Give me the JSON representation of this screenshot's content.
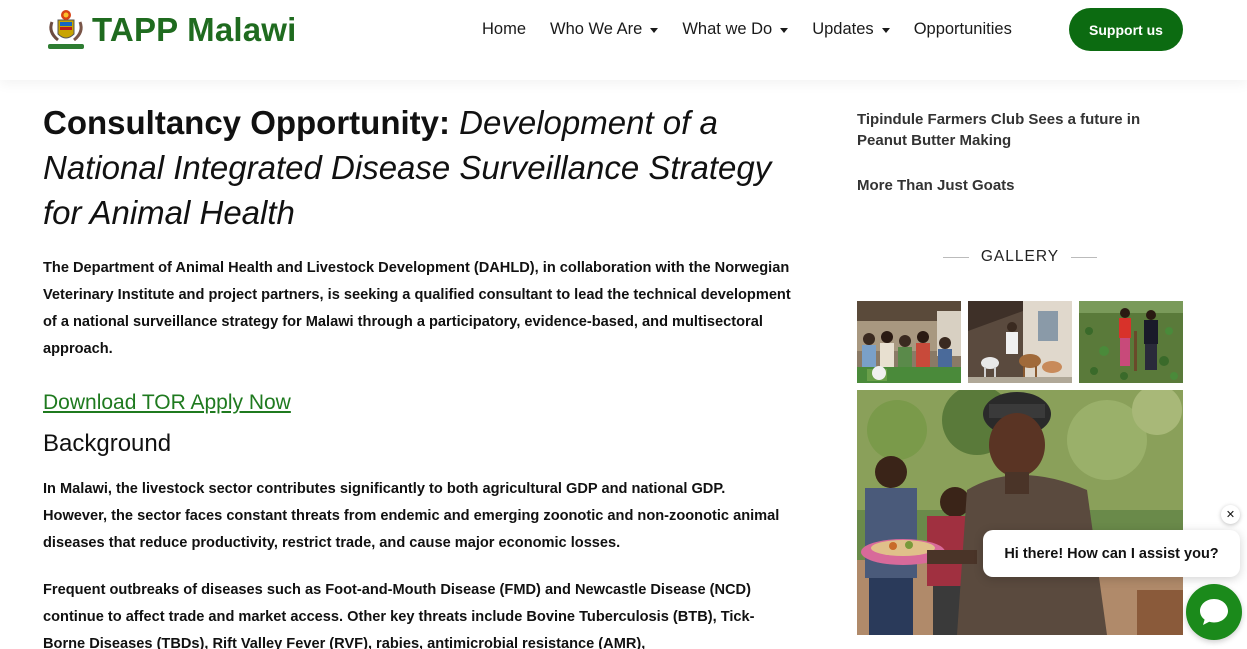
{
  "brand": {
    "name": "TAPP Malawi",
    "color": "#1f6b1f"
  },
  "nav": {
    "items": [
      {
        "label": "Home",
        "has_caret": false
      },
      {
        "label": "Who We Are",
        "has_caret": true
      },
      {
        "label": "What we Do",
        "has_caret": true
      },
      {
        "label": "Updates",
        "has_caret": true
      },
      {
        "label": "Opportunities",
        "has_caret": false
      }
    ],
    "support_label": "Support us",
    "support_color": "#0c6b11"
  },
  "article": {
    "title_prefix": "Consultancy Opportunity: ",
    "title_italic": "Development of a National Integrated Disease Surveillance Strategy for Animal Health",
    "intro": "The Department of Animal Health and Livestock Development (DAHLD), in collaboration with the Norwegian Veterinary Institute and project partners, is seeking a qualified consultant to lead the technical development of a national surveillance strategy for Malawi through a participatory, evidence-based, and multisectoral approach.",
    "download_link": "Download TOR Apply Now",
    "background_heading": "Background",
    "paragraph1": "In Malawi, the livestock sector contributes significantly to both agricultural GDP and national GDP. However, the sector faces constant threats from endemic and emerging zoonotic and non-zoonotic animal diseases that reduce productivity, restrict trade, and cause major economic losses.",
    "paragraph2": "Frequent outbreaks of diseases such as Foot-and-Mouth Disease (FMD) and Newcastle Disease (NCD) continue to affect trade and market access. Other key threats include Bovine Tuberculosis (BTB), Tick-Borne Diseases (TBDs), Rift Valley Fever (RVF), rabies, antimicrobial resistance (AMR),"
  },
  "sidebar": {
    "recent_links": [
      "Tipindule Farmers Club Sees a future in Peanut Butter Making",
      "More Than Just Goats"
    ],
    "gallery_title": "GALLERY",
    "gallery_icons": [
      "group-meeting-photo",
      "goats-photo",
      "farmers-field-photo",
      "woman-serving-food-photo"
    ]
  },
  "chat": {
    "message": "Hi there! How can I assist you?",
    "close_glyph": "✕",
    "button_color": "#1b8a1b"
  }
}
